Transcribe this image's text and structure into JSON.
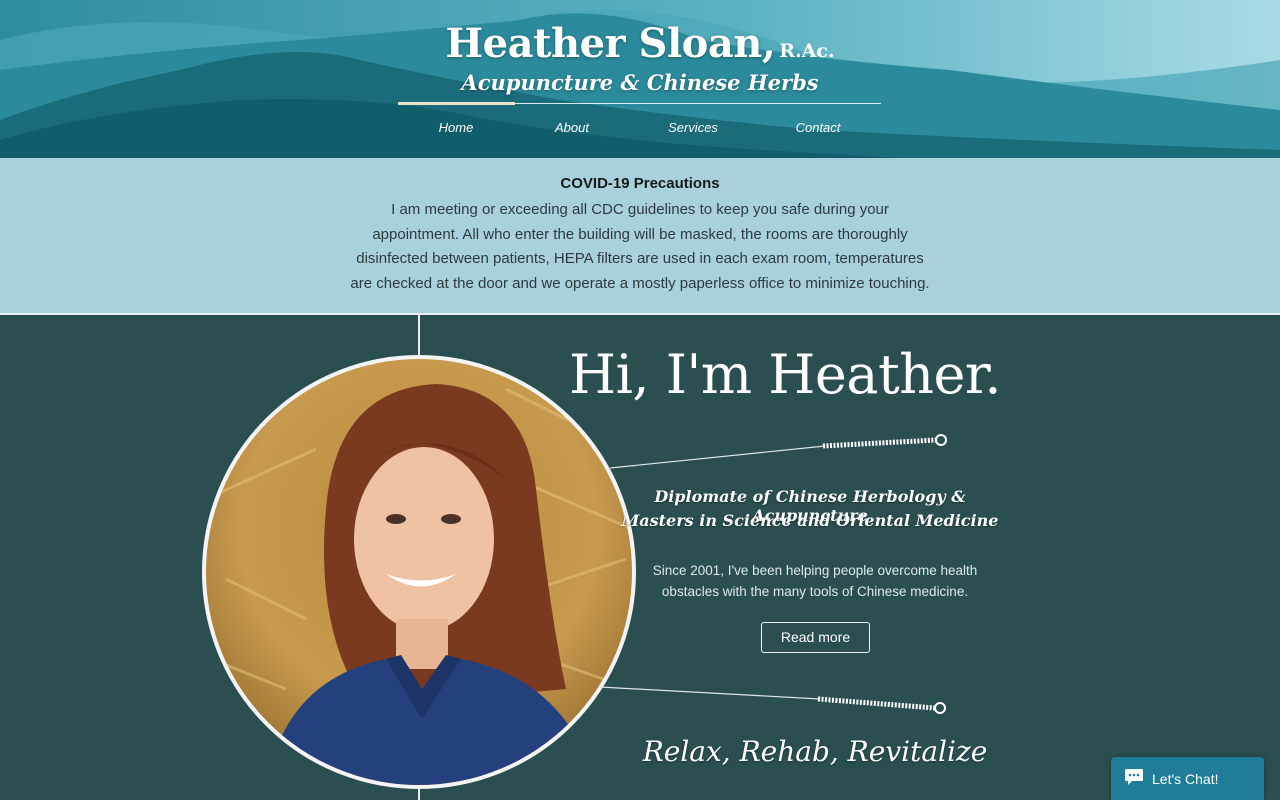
{
  "header": {
    "name": "Heather Sloan,",
    "credential": "R.Ac.",
    "subtitle": "Acupuncture & Chinese Herbs"
  },
  "nav": {
    "items": [
      {
        "label": "Home",
        "active": true
      },
      {
        "label": "About",
        "active": false
      },
      {
        "label": "Services",
        "active": false
      },
      {
        "label": "Contact",
        "active": false
      }
    ]
  },
  "covid": {
    "title": "COVID-19 Precautions",
    "text": "I am meeting or exceeding all CDC guidelines to keep you safe during your appointment. All who enter the building will be masked, the rooms are thoroughly disinfected between patients, HEPA filters are used in each exam room, temperatures are checked at the door and we operate a mostly paperless office to minimize touching."
  },
  "main": {
    "greeting": "Hi, I'm Heather.",
    "credential_1": "Diplomate of Chinese Herbology & Acupuncture",
    "credential_2": "Masters in Science and Oriental Medicine",
    "intro": "Since 2001, I've been helping people overcome health obstacles with the many tools of Chinese medicine.",
    "read_more": "Read more",
    "tagline": "Relax, Rehab, Revitalize",
    "photo_icon": "portrait-photo"
  },
  "chat": {
    "label": "Let's Chat!",
    "icon": "chat-bubble-icon"
  },
  "colors": {
    "main_bg": "#2b4f50",
    "covid_bg": "#a8d0dd",
    "chat_bg": "#1f7d9a",
    "header_teal": "#2c8fa0"
  }
}
